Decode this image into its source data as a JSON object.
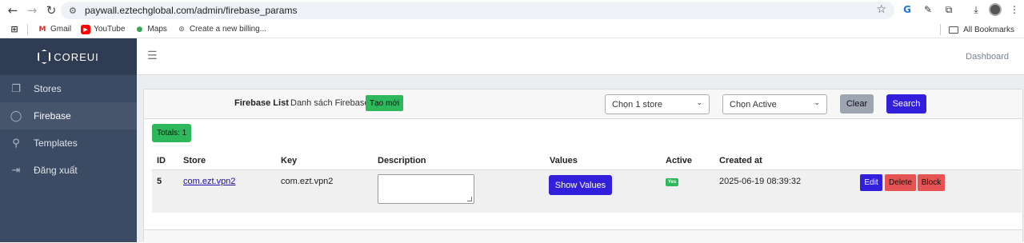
{
  "browser": {
    "url": "paywall.eztechglobal.com/admin/firebase_params",
    "bookmarks": [
      {
        "label": "Gmail"
      },
      {
        "label": "YouTube"
      },
      {
        "label": "Maps"
      },
      {
        "label": "Create a new billing..."
      }
    ],
    "all_bookmarks": "All Bookmarks"
  },
  "sidebar": {
    "brand": "COREUI",
    "items": [
      {
        "label": "Stores",
        "icon": "window-icon"
      },
      {
        "label": "Firebase",
        "icon": "mouse-icon",
        "active": true
      },
      {
        "label": "Templates",
        "icon": "paperclip-icon"
      },
      {
        "label": "Đăng xuất",
        "icon": "logout-icon"
      }
    ]
  },
  "header": {
    "dashboard": "Dashboard"
  },
  "filters": {
    "title": "Firebase List",
    "subtitle": "Danh sách Firebase",
    "create_label": "Tạo mới",
    "store_select": "Chọn 1 store",
    "active_select": "Chọn Active",
    "clear_label": "Clear",
    "search_label": "Search"
  },
  "totals": "Totals: 1",
  "table": {
    "columns": [
      "ID",
      "Store",
      "Key",
      "Description",
      "Values",
      "Active",
      "Created at"
    ],
    "rows": [
      {
        "id": "5",
        "store": "com.ezt.vpn2",
        "key": "com.ezt.vpn2",
        "description": "",
        "values_button": "Show Values",
        "active": "Yes",
        "created_at": "2025-06-19 08:39:32",
        "actions": {
          "edit": "Edit",
          "delete": "Delete",
          "block": "Block"
        }
      }
    ]
  },
  "colors": {
    "sidebar": "#3c4b64",
    "primary": "#321fdb",
    "success": "#2eb85c",
    "danger": "#e55353",
    "secondary": "#9da5b1"
  }
}
